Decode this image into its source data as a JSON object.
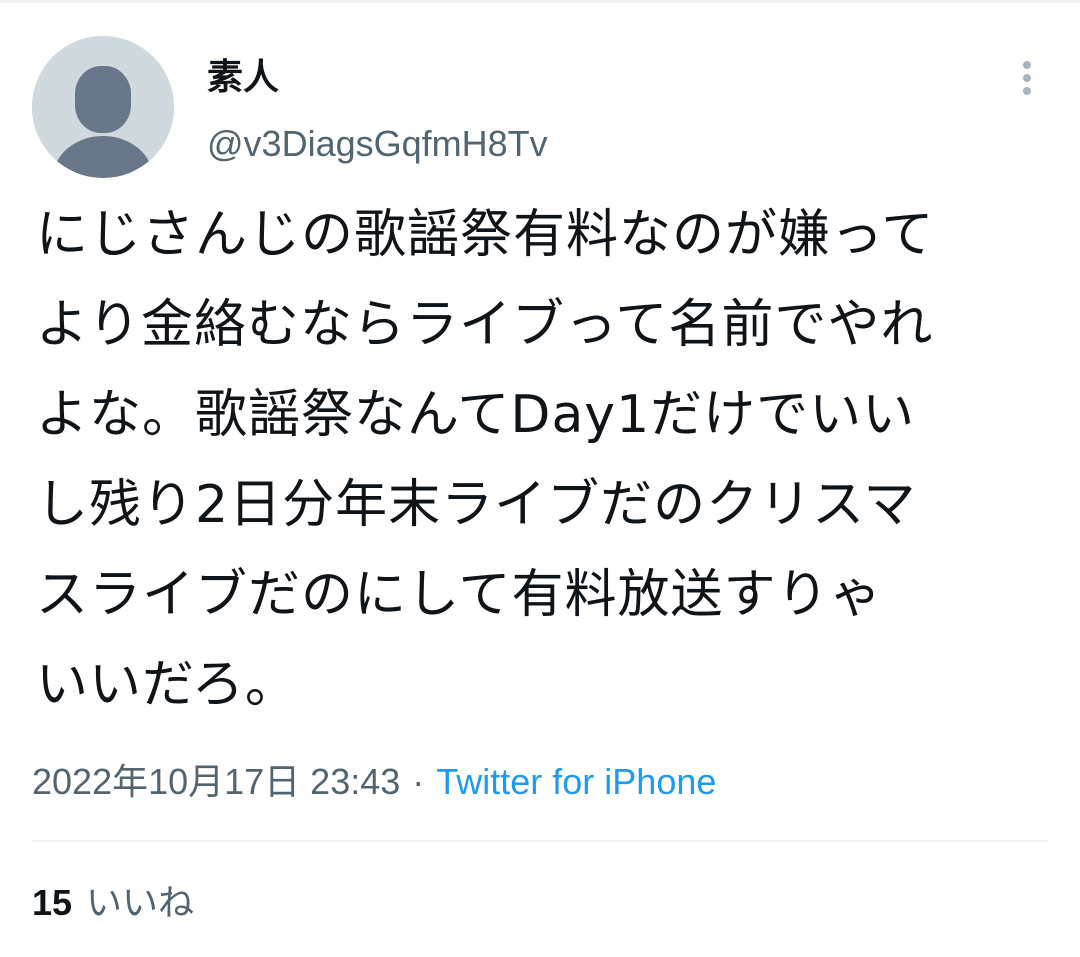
{
  "tweet": {
    "author": {
      "display_name": "素人",
      "handle": "@v3DiagsGqfmH8Tv"
    },
    "text_lines": [
      "にじさんじの歌謡祭有料なのが嫌って",
      "より金絡むならライブって名前でやれ",
      "よな。歌謡祭なんてDay1だけでいい",
      "し残り2日分年末ライブだのクリスマ",
      "スライブだのにして有料放送すりゃ",
      "いいだろ。"
    ],
    "timestamp": "2022年10月17日 23:43",
    "separator": "·",
    "source": "Twitter for iPhone",
    "likes": {
      "count": "15",
      "label": "いいね"
    }
  },
  "icons": {
    "avatar": "default-avatar-icon",
    "more": "more-vertical-icon"
  },
  "colors": {
    "text": "#0f1419",
    "secondary": "#536471",
    "link": "#1d9bf0",
    "avatar_bg": "#cfd9de",
    "avatar_fg": "#68788a"
  }
}
